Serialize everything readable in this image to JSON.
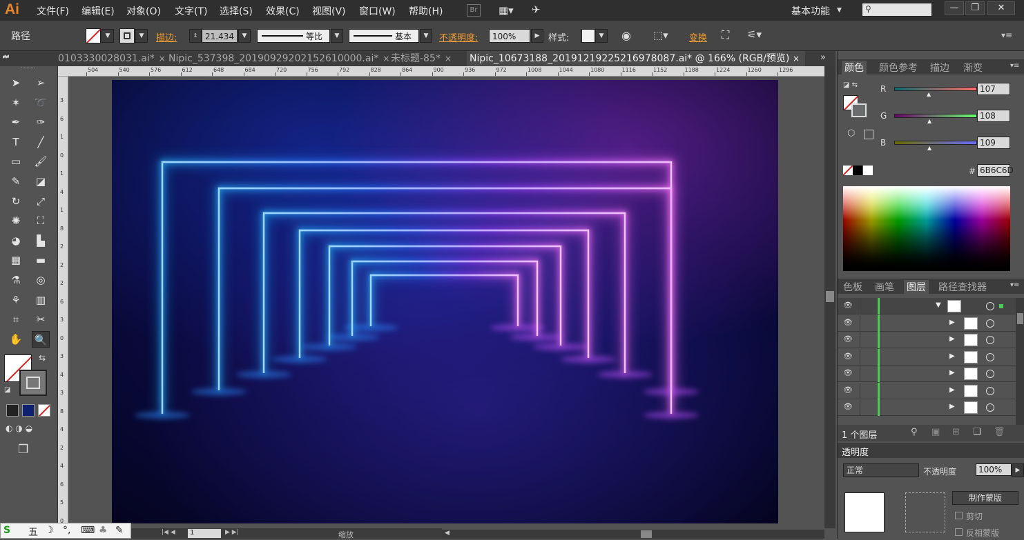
{
  "app": {
    "logo": "Ai"
  },
  "menu": [
    "文件(F)",
    "编辑(E)",
    "对象(O)",
    "文字(T)",
    "选择(S)",
    "效果(C)",
    "视图(V)",
    "窗口(W)",
    "帮助(H)"
  ],
  "menu_icons": {
    "bridge": "Br",
    "layout": "layout-icon",
    "sync": "sync-icon"
  },
  "workspace": {
    "label": "基本功能",
    "search_placeholder": ""
  },
  "window_buttons": {
    "minimize": "—",
    "restore": "❐",
    "close": "✕"
  },
  "control": {
    "object_label": "路径",
    "stroke_label": "描边:",
    "stroke_value": "21.434",
    "profile_label": "等比",
    "brush_label": "基本",
    "opacity_label": "不透明度:",
    "opacity_value": "100%",
    "style_label": "样式:",
    "transform_label": "变换"
  },
  "tabs": [
    {
      "label": "0103330028031.ai*",
      "active": false
    },
    {
      "label": "Nipic_537398_20190929202152610000.ai*",
      "active": false
    },
    {
      "label": "未标题-85*",
      "active": false
    },
    {
      "label": "Nipic_10673188_20191219225216978087.ai* @ 166% (RGB/预览)",
      "active": true
    }
  ],
  "ruler_top": [
    "504",
    "540",
    "576",
    "612",
    "648",
    "684",
    "720",
    "756",
    "792",
    "828",
    "864",
    "900",
    "936",
    "972",
    "1008",
    "1044",
    "1080",
    "1116",
    "1152",
    "1188",
    "1224",
    "1260",
    "1296"
  ],
  "ruler_left": [
    "3",
    "6",
    "1",
    "0",
    "1",
    "4",
    "1",
    "8",
    "2",
    "2",
    "2",
    "6",
    "3",
    "0",
    "3",
    "4",
    "3",
    "8",
    "4",
    "2",
    "4",
    "6",
    "5",
    "0"
  ],
  "tools": [
    "selection-icon",
    "direct-selection-icon",
    "magic-wand-icon",
    "lasso-icon",
    "pen-icon",
    "curvature-icon",
    "type-icon",
    "line-icon",
    "rectangle-icon",
    "brush-icon",
    "pencil-icon",
    "eraser-icon",
    "rotate-icon",
    "scale-icon",
    "warp-icon",
    "free-transform-icon",
    "shape-builder-icon",
    "graph-icon",
    "mesh-icon",
    "gradient-icon",
    "eyedropper-icon",
    "blend-icon",
    "symbol-sprayer-icon",
    "column-graph-icon",
    "artboard-icon",
    "slice-icon",
    "hand-icon",
    "zoom-icon"
  ],
  "color_panel": {
    "tabs": [
      "颜色",
      "颜色参考",
      "描边",
      "渐变"
    ],
    "r_label": "R",
    "g_label": "G",
    "b_label": "B",
    "r": 107,
    "g": 108,
    "b": 109,
    "hex_label": "#",
    "hex": "6B6C6D"
  },
  "layers_panel": {
    "tabs": [
      "色板",
      "画笔",
      "图层",
      "路径查找器"
    ],
    "rows": 7,
    "count_label": "1 个图层"
  },
  "transparency_panel": {
    "title": "透明度",
    "mode": "正常",
    "opacity_label": "不透明度",
    "opacity": "100%",
    "make_mask": "制作蒙版",
    "clip": "剪切",
    "invert": "反相蒙版"
  },
  "status": {
    "zoom_label": "缩放",
    "page": "1"
  },
  "ime": {
    "label": "五"
  },
  "colors": {
    "accent_orange": "#f09c33",
    "logo": "#e8862a",
    "layer_bar": "#4fc95a",
    "neon_blue": "#2a8cff",
    "neon_pink": "#f06cff"
  }
}
